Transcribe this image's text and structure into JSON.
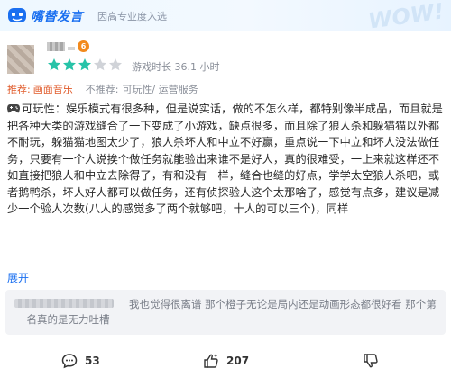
{
  "header": {
    "logo_text": "嘴替发言",
    "tagline": "因高专业度入选",
    "decoration_text": "WOW!"
  },
  "review": {
    "level_badge": "6",
    "rating": 3,
    "rating_max": 5,
    "playtime": "游戏时长 36.1 小时",
    "recommend_label": "推荐:",
    "recommend_value": "画面音乐",
    "not_recommend_label": "不推荐:",
    "not_recommend_value": "可玩性/ 运营服务",
    "body": "可玩性：娱乐模式有很多种，但是说实话，做的不怎么样，都特别像半成品，而且就是把各种大类的游戏缝合了一下变成了小游戏，缺点很多，而且除了狼人杀和躲猫猫以外都不耐玩，躲猫猫地图太少了，狼人杀坏人和中立不好赢，重点说一下中立和坏人没法做任务，只要有一个人说挨个做任务就能验出来谁不是好人，真的很难受，一上来就这样还不如直接把狼人和中立去除得了，有和没有一样，缝合也缝的好点，学学太空狼人杀吧，或者鹅鸭杀，坏人好人都可以做任务，还有侦探验人这个太那啥了，感觉有点多，建议是减少一个验人次数(八人的感觉多了两个就够吧，十人的可以三个)，同样",
    "expand_label": "展开"
  },
  "comment": {
    "text": "我也觉得很离谱 那个橙子无论是局内还是动画形态都很好看 那个第一名真的是无力吐槽"
  },
  "actions": {
    "comment_count": "53",
    "like_count": "207"
  },
  "colors": {
    "accent_blue": "#1a6ff0",
    "star_filled": "#27c3a8",
    "star_empty": "#d0d3d8",
    "recommend": "#e05a2a"
  }
}
